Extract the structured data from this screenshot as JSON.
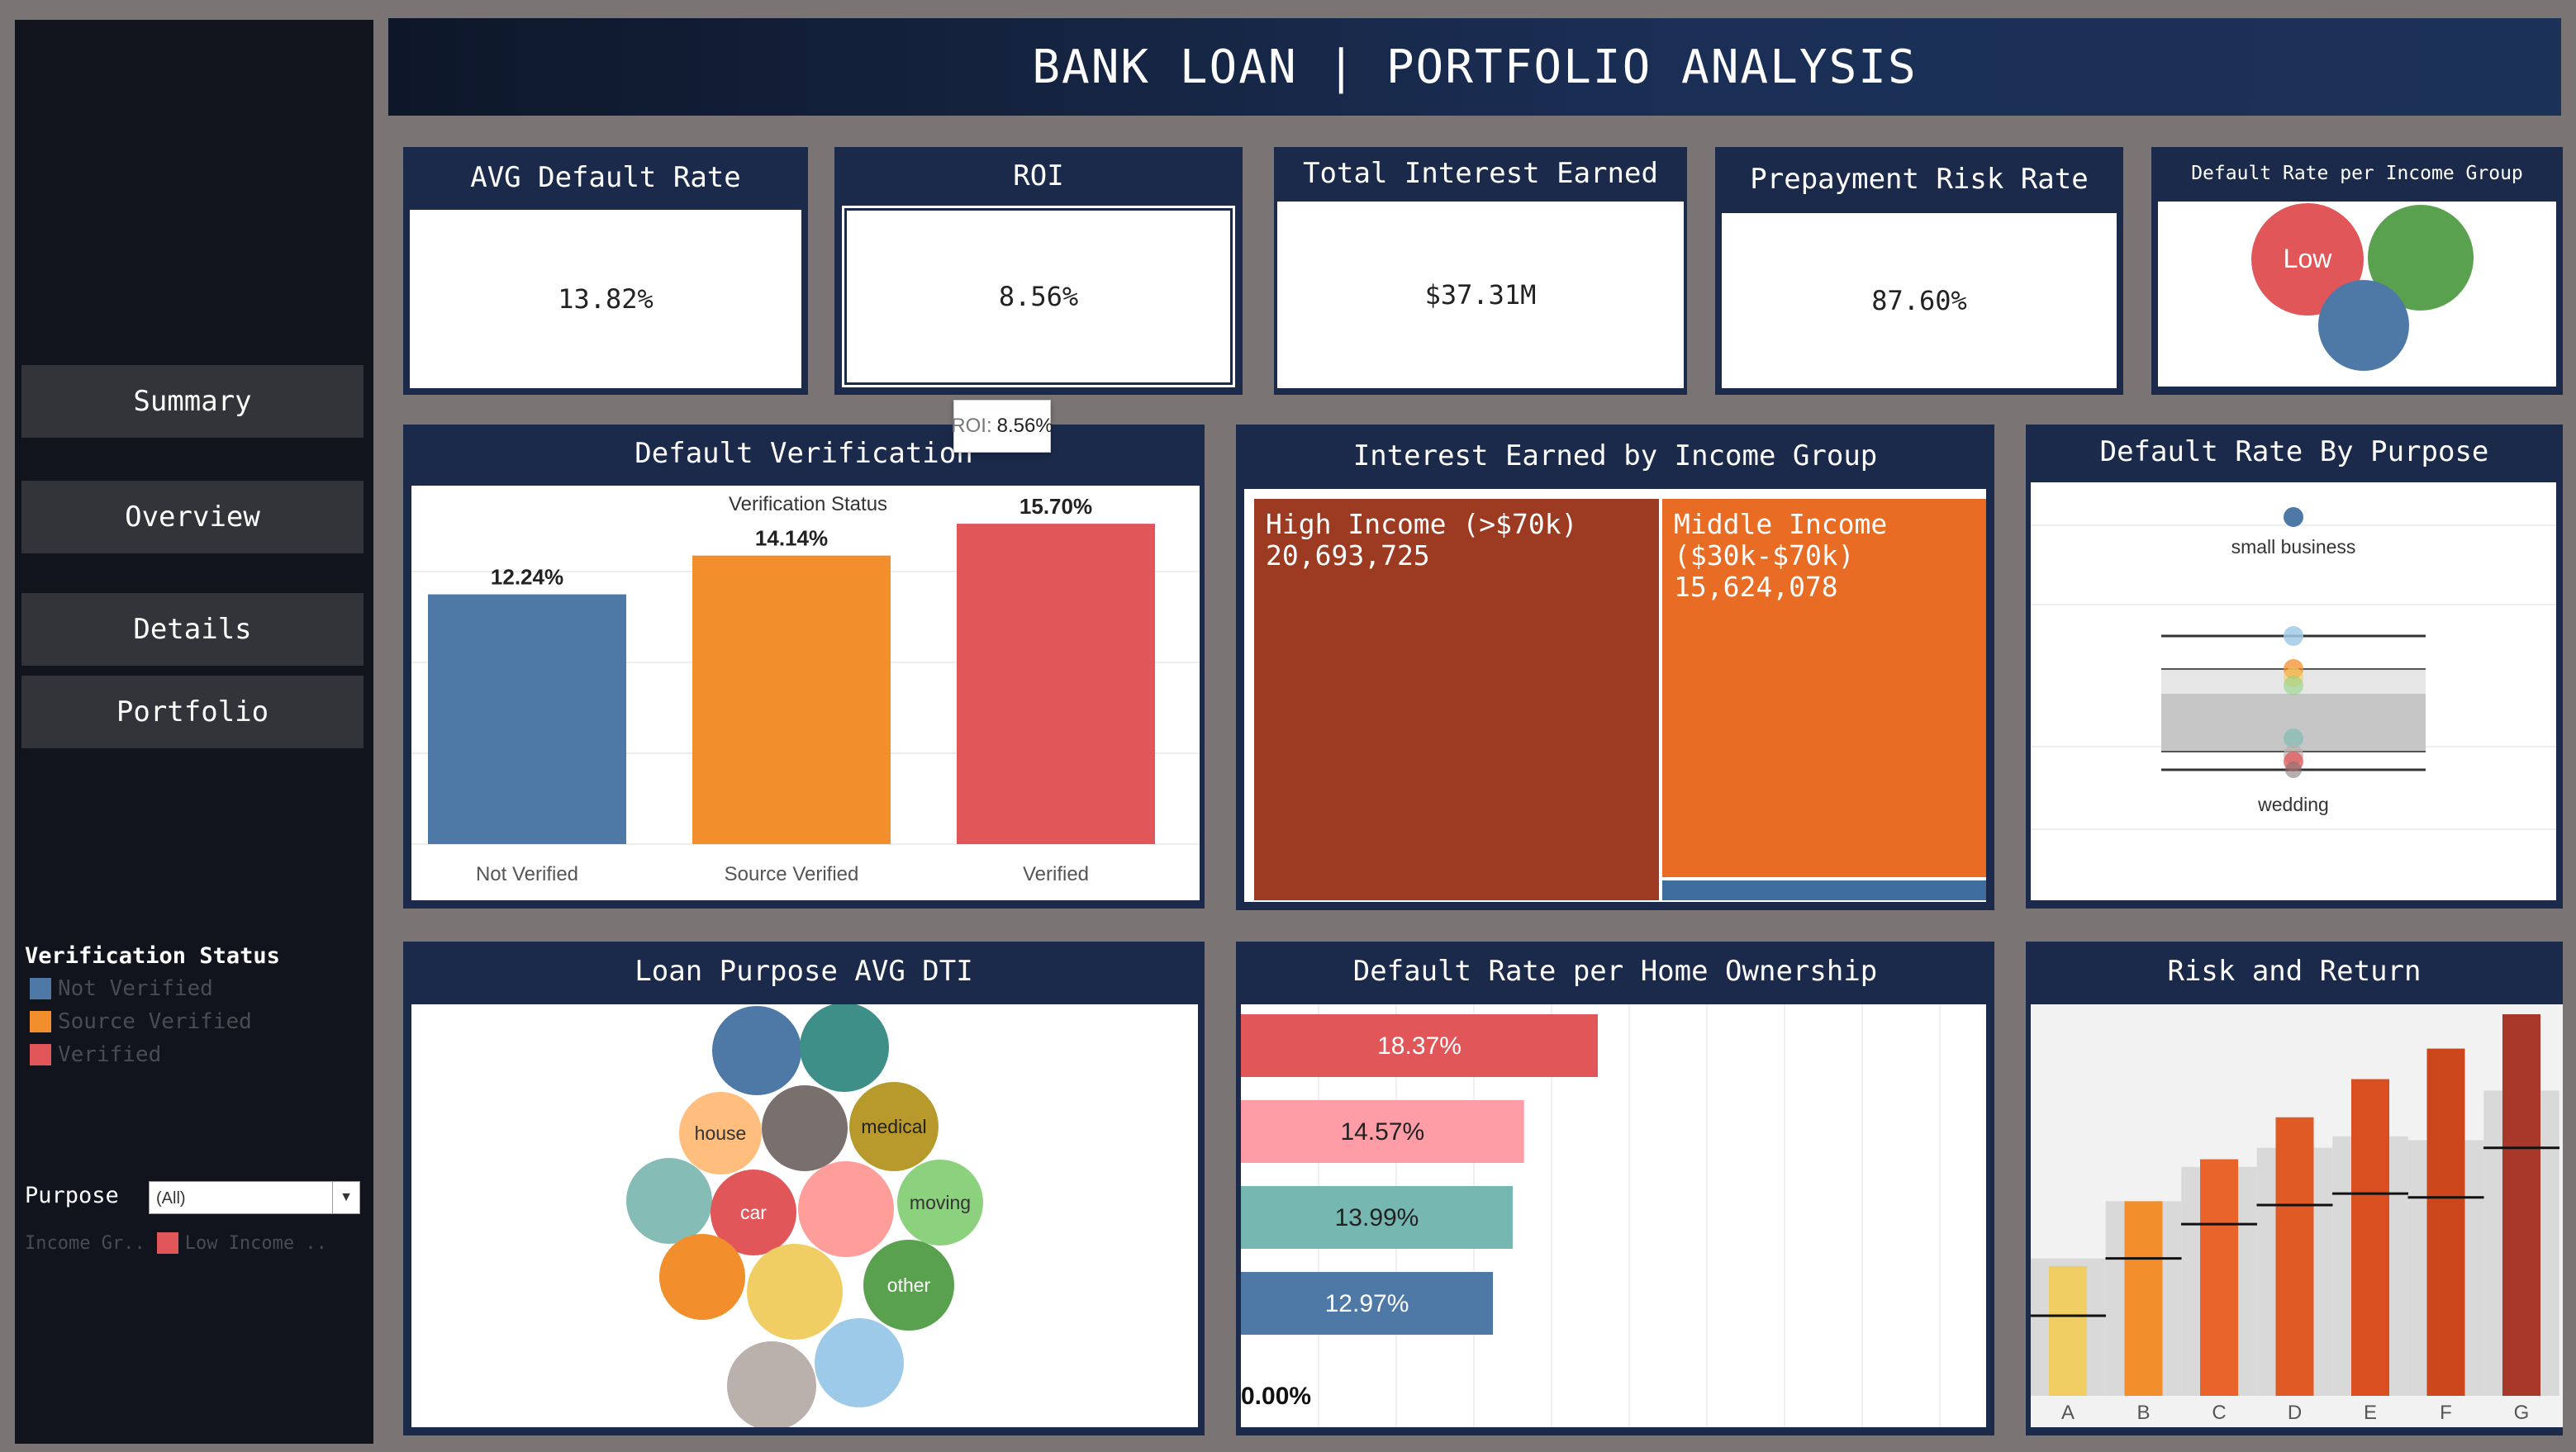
{
  "header": {
    "title": "BANK LOAN | PORTFOLIO  ANALYSIS"
  },
  "nav": {
    "items": [
      "Summary",
      "Overview",
      "Details",
      "Portfolio"
    ]
  },
  "filters": {
    "verification_title": "Verification Status",
    "verification_items": [
      {
        "label": "Not Verified",
        "color": "#4e79a7"
      },
      {
        "label": "Source Verified",
        "color": "#f28e2b"
      },
      {
        "label": "Verified",
        "color": "#e15759"
      }
    ],
    "purpose_label": "Purpose",
    "purpose_value": "(All)",
    "income_label": "Income Gr..",
    "income_value": "Low Income .."
  },
  "kpis": [
    {
      "title": "AVG Default Rate",
      "value": "13.82%"
    },
    {
      "title": "ROI",
      "value": "8.56%"
    },
    {
      "title": "Total Interest Earned",
      "value": "$37.31M"
    },
    {
      "title": "Prepayment Risk Rate",
      "value": "87.60%"
    }
  ],
  "tooltip": {
    "label": "ROI:",
    "value": "8.56%"
  },
  "income_bubbles": {
    "title": "Default Rate per Income Group",
    "bubbles": [
      {
        "label": "Low",
        "color": "#e15759"
      },
      {
        "label": "",
        "color": "#59a14f"
      },
      {
        "label": "",
        "color": "#4e79a7"
      }
    ]
  },
  "verification_chart": {
    "title": "Default Verification",
    "subtitle": "Verification Status"
  },
  "treemap": {
    "title": "Interest Earned by Income Group",
    "tiles": [
      {
        "label": "High Income (>$70k)",
        "value": "20,693,725",
        "color": "#9c3b21"
      },
      {
        "label": "Middle Income ($30k-$70k)",
        "value": "15,624,078",
        "color": "#e86c24"
      },
      {
        "label": "",
        "value": "",
        "color": "#3f6e9e"
      }
    ]
  },
  "purpose_rate": {
    "title": "Default Rate By Purpose",
    "top_label": "small business",
    "bottom_label": "wedding"
  },
  "dti_bubbles": {
    "title": "Loan Purpose AVG DTI",
    "bubbles": [
      {
        "label": "",
        "color": "#4e79a7"
      },
      {
        "label": "",
        "color": "#3e8f88"
      },
      {
        "label": "house",
        "color": "#ffbe7d"
      },
      {
        "label": "",
        "color": "#79706e"
      },
      {
        "label": "medical",
        "color": "#b89a2c"
      },
      {
        "label": "",
        "color": "#86bcb6"
      },
      {
        "label": "car",
        "color": "#e15759"
      },
      {
        "label": "",
        "color": "#ff9d9a"
      },
      {
        "label": "moving",
        "color": "#8cd17d"
      },
      {
        "label": "",
        "color": "#f28e2b"
      },
      {
        "label": "",
        "color": "#f1ce63"
      },
      {
        "label": "other",
        "color": "#59a14f"
      },
      {
        "label": "",
        "color": "#9ecae9"
      },
      {
        "label": "",
        "color": "#bab0ac"
      }
    ]
  },
  "home_ownership": {
    "title": "Default Rate per Home Ownership",
    "zero_label": "0.00%"
  },
  "risk_return": {
    "title": "Risk and Return"
  },
  "chart_data": [
    {
      "type": "bar",
      "title": "Default Verification",
      "subtitle": "Verification Status",
      "categories": [
        "Not Verified",
        "Source Verified",
        "Verified"
      ],
      "values": [
        12.24,
        14.14,
        15.7
      ],
      "labels": [
        "12.24%",
        "14.14%",
        "15.70%"
      ],
      "colors": [
        "#4e79a7",
        "#f28e2b",
        "#e15759"
      ],
      "ylim": [
        0,
        17
      ]
    },
    {
      "type": "bar",
      "orientation": "horizontal",
      "title": "Default Rate per Home Ownership",
      "values": [
        18.37,
        14.57,
        13.99,
        12.97,
        0.0
      ],
      "labels": [
        "18.37%",
        "14.57%",
        "13.99%",
        "12.97%",
        "0.00%"
      ],
      "colors": [
        "#e15759",
        "#ff9da7",
        "#76b7b2",
        "#4e79a7",
        "#4e79a7"
      ],
      "xlim": [
        0,
        19
      ]
    },
    {
      "type": "bar",
      "title": "Risk and Return",
      "categories": [
        "A",
        "B",
        "C",
        "D",
        "E",
        "F",
        "G"
      ],
      "values": [
        34,
        51,
        62,
        73,
        83,
        91,
        100
      ],
      "reference_values": [
        21,
        36,
        45,
        50,
        53,
        52,
        65
      ],
      "colors": [
        "#f1ce63",
        "#f28e2b",
        "#e8642a",
        "#df5a24",
        "#d94f1f",
        "#cc461c",
        "#a8382a"
      ],
      "ylim": [
        0,
        100
      ]
    },
    {
      "type": "scatter",
      "title": "Default Rate By Purpose",
      "annotations": [
        "small business",
        "wedding"
      ]
    }
  ]
}
